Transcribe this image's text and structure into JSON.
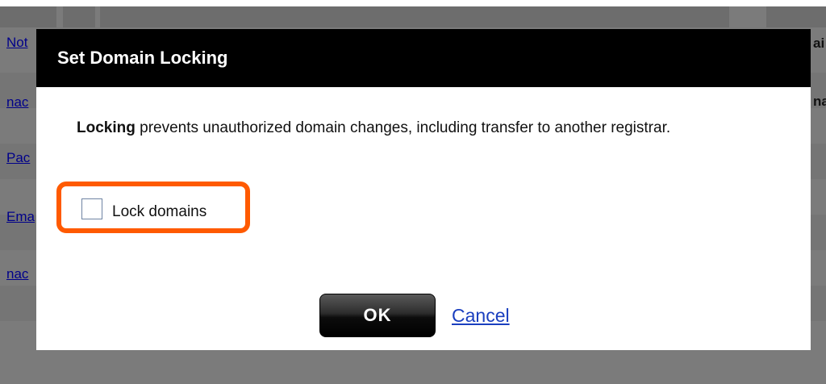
{
  "background": {
    "links": [
      "Not",
      "nac",
      "Pac",
      "Ema",
      "nac"
    ],
    "right_labels": [
      "ai",
      "na"
    ]
  },
  "dialog": {
    "title": "Set Domain Locking",
    "message_bold": "Locking",
    "message_rest": " prevents unauthorized domain changes, including transfer to another registrar.",
    "checkbox_label": "Lock domains",
    "checkbox_checked": false,
    "ok_label": "OK",
    "cancel_label": "Cancel"
  },
  "colors": {
    "header": "#000000",
    "highlight": "#ff5a00",
    "link": "#1a3fbf"
  }
}
